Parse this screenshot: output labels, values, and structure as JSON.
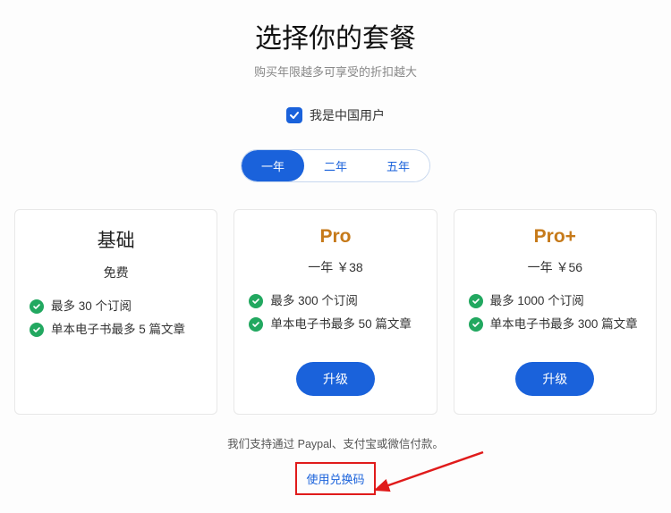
{
  "header": {
    "title": "选择你的套餐",
    "subtitle": "购买年限越多可享受的折扣越大"
  },
  "checkbox": {
    "label": "我是中国用户",
    "checked": true
  },
  "tabs": {
    "items": [
      "一年",
      "二年",
      "五年"
    ],
    "active_index": 0
  },
  "plans": [
    {
      "name": "基础",
      "price": "免费",
      "features": [
        "最多 30 个订阅",
        "单本电子书最多 5 篇文章"
      ],
      "button": null,
      "name_class": "free"
    },
    {
      "name": "Pro",
      "price": "一年 ￥38",
      "features": [
        "最多 300 个订阅",
        "单本电子书最多 50 篇文章"
      ],
      "button": "升级",
      "name_class": "pro"
    },
    {
      "name": "Pro+",
      "price": "一年 ￥56",
      "features": [
        "最多 1000 个订阅",
        "单本电子书最多 300 篇文章"
      ],
      "button": "升级",
      "name_class": "pro"
    }
  ],
  "footer": {
    "note": "我们支持通过 Paypal、支付宝或微信付款。",
    "redeem_label": "使用兑换码"
  }
}
